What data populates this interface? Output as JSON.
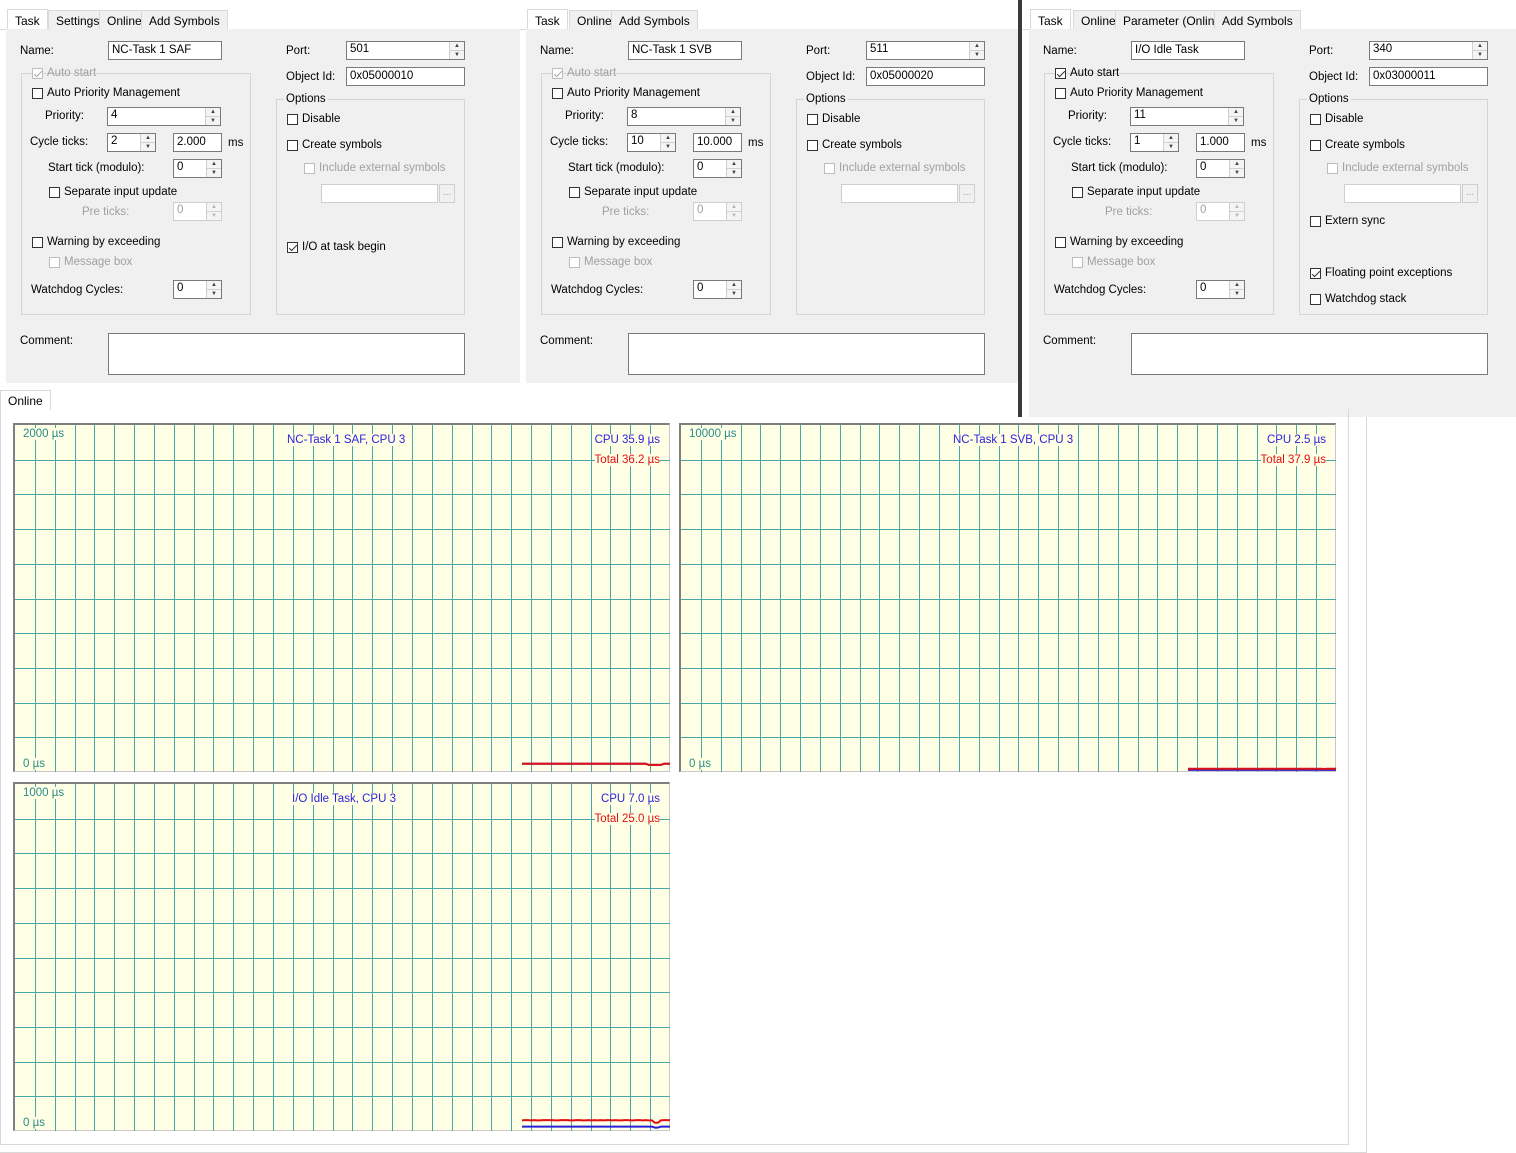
{
  "panel1": {
    "tabs": [
      "Task",
      "Settings",
      "Online",
      "Add Symbols"
    ],
    "name_label": "Name:",
    "name_value": "NC-Task 1 SAF",
    "auto_start": "Auto start",
    "auto_priority": "Auto Priority Management",
    "priority_label": "Priority:",
    "priority_value": "4",
    "cycle_label": "Cycle ticks:",
    "cycle_value": "2",
    "cycle_ms": "2.000",
    "ms": "ms",
    "start_tick_label": "Start tick (modulo):",
    "start_tick_value": "0",
    "separate_input": "Separate input update",
    "pre_ticks_label": "Pre ticks:",
    "pre_ticks_value": "0",
    "warning": "Warning by exceeding",
    "message_box": "Message box",
    "watchdog_label": "Watchdog Cycles:",
    "watchdog_value": "0",
    "port_label": "Port:",
    "port_value": "501",
    "objid_label": "Object Id:",
    "objid_value": "0x05000010",
    "options": "Options",
    "disable": "Disable",
    "create_symbols": "Create symbols",
    "include_external": "Include external symbols",
    "browse": "...",
    "io_task_begin": "I/O at task begin",
    "comment_label": "Comment:"
  },
  "panel2": {
    "tabs": [
      "Task",
      "Online",
      "Add Symbols"
    ],
    "name_label": "Name:",
    "name_value": "NC-Task 1 SVB",
    "auto_start": "Auto start",
    "auto_priority": "Auto Priority Management",
    "priority_label": "Priority:",
    "priority_value": "8",
    "cycle_label": "Cycle ticks:",
    "cycle_value": "10",
    "cycle_ms": "10.000",
    "ms": "ms",
    "start_tick_label": "Start tick (modulo):",
    "start_tick_value": "0",
    "separate_input": "Separate input update",
    "pre_ticks_label": "Pre ticks:",
    "pre_ticks_value": "0",
    "warning": "Warning by exceeding",
    "message_box": "Message box",
    "watchdog_label": "Watchdog Cycles:",
    "watchdog_value": "0",
    "port_label": "Port:",
    "port_value": "511",
    "objid_label": "Object Id:",
    "objid_value": "0x05000020",
    "options": "Options",
    "disable": "Disable",
    "create_symbols": "Create symbols",
    "include_external": "Include external symbols",
    "browse": "...",
    "comment_label": "Comment:"
  },
  "panel3": {
    "tabs": [
      "Task",
      "Online",
      "Parameter (Online)",
      "Add Symbols"
    ],
    "name_label": "Name:",
    "name_value": "I/O Idle Task",
    "auto_start": "Auto start",
    "auto_priority": "Auto Priority Management",
    "priority_label": "Priority:",
    "priority_value": "11",
    "cycle_label": "Cycle ticks:",
    "cycle_value": "1",
    "cycle_ms": "1.000",
    "ms": "ms",
    "start_tick_label": "Start tick (modulo):",
    "start_tick_value": "0",
    "separate_input": "Separate input update",
    "pre_ticks_label": "Pre ticks:",
    "pre_ticks_value": "0",
    "warning": "Warning by exceeding",
    "message_box": "Message box",
    "watchdog_label": "Watchdog Cycles:",
    "watchdog_value": "0",
    "port_label": "Port:",
    "port_value": "340",
    "objid_label": "Object Id:",
    "objid_value": "0x03000011",
    "options": "Options",
    "disable": "Disable",
    "create_symbols": "Create symbols",
    "include_external": "Include external symbols",
    "browse": "...",
    "extern_sync": "Extern sync",
    "floating_point": "Floating point exceptions",
    "watchdog_stack": "Watchdog stack",
    "comment_label": "Comment:"
  },
  "online_tab": "Online",
  "colors": {
    "chart_bg": "#ffffe6",
    "grid": "#4aa7a7",
    "cpu": "#2a1fd8",
    "total": "#e01010"
  },
  "chart_data": [
    {
      "type": "line",
      "title": "NC-Task 1 SAF, CPU 3",
      "ymax_label": "2000 µs",
      "ymin_label": "0 µs",
      "cpu_label": "CPU 35.9 µs",
      "total_label": "Total 36.2 µs",
      "ylim": [
        0,
        2000
      ],
      "series": [
        {
          "name": "CPU",
          "values": [
            36,
            36,
            36,
            36,
            36,
            36,
            36,
            36,
            36,
            36,
            36,
            36,
            36,
            36,
            36,
            36,
            36,
            36,
            36,
            36,
            36,
            36,
            36,
            36,
            36,
            36,
            36,
            36,
            36,
            36,
            36,
            36,
            36,
            36,
            36,
            36,
            36,
            36,
            36,
            36,
            36,
            36,
            30,
            30,
            30,
            30,
            30,
            36,
            36,
            36
          ]
        },
        {
          "name": "Total",
          "values": [
            36,
            36,
            36,
            36,
            36,
            36,
            36,
            36,
            36,
            36,
            36,
            36,
            36,
            36,
            36,
            36,
            36,
            36,
            36,
            36,
            36,
            36,
            36,
            36,
            36,
            36,
            36,
            36,
            36,
            36,
            36,
            36,
            36,
            36,
            36,
            36,
            36,
            36,
            36,
            36,
            36,
            36,
            30,
            30,
            30,
            30,
            30,
            36,
            36,
            36
          ]
        }
      ]
    },
    {
      "type": "line",
      "title": "NC-Task 1 SVB, CPU 3",
      "ymax_label": "10000 µs",
      "ymin_label": "0 µs",
      "cpu_label": "CPU 2.5 µs",
      "total_label": "Total 37.9 µs",
      "ylim": [
        0,
        10000
      ],
      "series": [
        {
          "name": "CPU",
          "values": [
            3,
            3,
            3,
            3,
            3,
            3,
            3,
            3,
            3,
            3,
            3,
            3,
            3,
            3,
            3,
            3,
            3,
            3,
            3,
            3,
            3,
            3,
            3,
            3,
            3,
            3,
            3,
            3,
            3,
            3,
            3,
            3,
            3,
            3,
            3,
            3,
            3,
            3,
            3,
            3,
            3,
            3,
            3,
            3,
            3,
            3,
            3,
            3,
            3,
            3
          ]
        },
        {
          "name": "Total",
          "values": [
            38,
            38,
            38,
            38,
            38,
            38,
            38,
            38,
            38,
            38,
            38,
            38,
            38,
            38,
            38,
            38,
            38,
            38,
            38,
            38,
            38,
            38,
            38,
            38,
            38,
            38,
            38,
            38,
            38,
            38,
            38,
            38,
            38,
            38,
            38,
            38,
            38,
            38,
            38,
            38,
            38,
            38,
            38,
            38,
            38,
            30,
            38,
            38,
            38,
            38
          ]
        }
      ]
    },
    {
      "type": "line",
      "title": "I/O Idle Task, CPU 3",
      "ymax_label": "1000 µs",
      "ymin_label": "0 µs",
      "cpu_label": "CPU 7.0 µs",
      "total_label": "Total 25.0 µs",
      "ylim": [
        0,
        1000
      ],
      "series": [
        {
          "name": "CPU",
          "values": [
            7,
            7,
            7,
            7,
            7,
            7,
            7,
            7,
            7,
            7,
            7,
            7,
            7,
            7,
            7,
            7,
            7,
            7,
            7,
            7,
            7,
            7,
            7,
            7,
            7,
            7,
            7,
            7,
            7,
            7,
            7,
            7,
            7,
            7,
            7,
            7,
            7,
            7,
            7,
            7,
            7,
            7,
            7,
            7,
            4,
            4,
            7,
            7,
            7,
            7
          ]
        },
        {
          "name": "Total",
          "values": [
            25,
            26,
            26,
            25,
            26,
            25,
            25,
            26,
            26,
            26,
            26,
            25,
            25,
            26,
            26,
            26,
            25,
            25,
            26,
            26,
            25,
            25,
            26,
            25,
            26,
            25,
            26,
            25,
            26,
            26,
            25,
            26,
            25,
            25,
            26,
            26,
            25,
            25,
            26,
            26,
            25,
            26,
            25,
            25,
            18,
            18,
            25,
            26,
            26,
            26
          ]
        }
      ]
    }
  ]
}
